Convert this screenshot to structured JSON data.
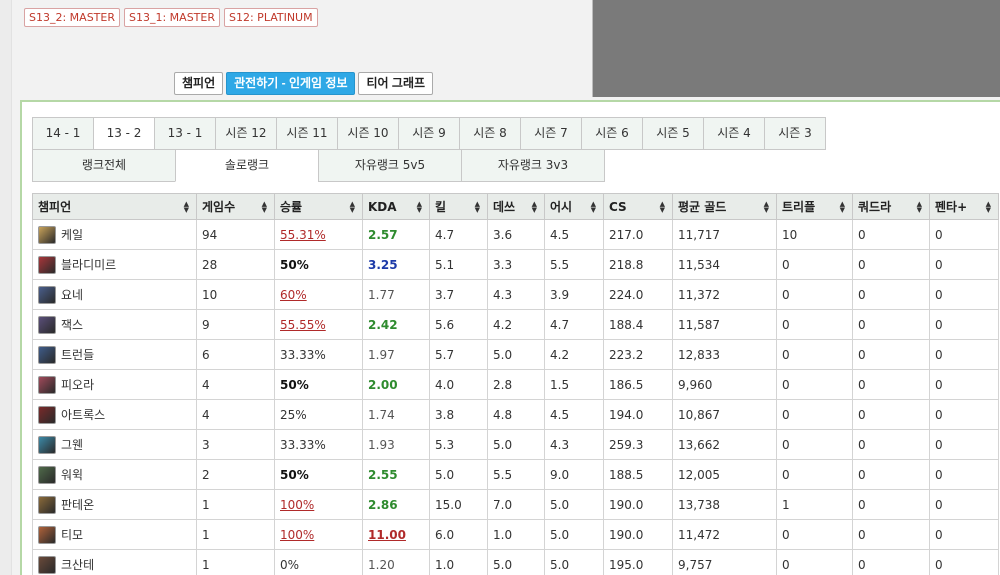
{
  "tier_badges": [
    "S13_2: MASTER",
    "S13_1: MASTER",
    "S12: PLATINUM"
  ],
  "view_tabs": [
    {
      "label": "챔피언",
      "active": false
    },
    {
      "label": "관전하기 - 인게임 정보",
      "active": true
    },
    {
      "label": "티어 그래프",
      "active": false
    }
  ],
  "season_tabs": [
    {
      "label": "14 - 1",
      "active": false
    },
    {
      "label": "13 - 2",
      "active": true
    },
    {
      "label": "13 - 1",
      "active": false
    },
    {
      "label": "시즌 12",
      "active": false
    },
    {
      "label": "시즌 11",
      "active": false
    },
    {
      "label": "시즌 10",
      "active": false
    },
    {
      "label": "시즌 9",
      "active": false
    },
    {
      "label": "시즌 8",
      "active": false
    },
    {
      "label": "시즌 7",
      "active": false
    },
    {
      "label": "시즌 6",
      "active": false
    },
    {
      "label": "시즌 5",
      "active": false
    },
    {
      "label": "시즌 4",
      "active": false
    },
    {
      "label": "시즌 3",
      "active": false
    }
  ],
  "rank_tabs": [
    {
      "label": "랭크전체",
      "active": false
    },
    {
      "label": "솔로랭크",
      "active": true
    },
    {
      "label": "자유랭크 5v5",
      "active": false
    },
    {
      "label": "자유랭크 3v3",
      "active": false
    }
  ],
  "table": {
    "headers": [
      "챔피언",
      "게임수",
      "승률",
      "KDA",
      "킬",
      "데쓰",
      "어시",
      "CS",
      "평균 골드",
      "트리플",
      "쿼드라",
      "펜타+"
    ],
    "rows": [
      {
        "champion": "케일",
        "games": "94",
        "winrate": "55.31%",
        "wr_style": "red",
        "kda": "2.57",
        "kda_style": "green",
        "kills": "4.7",
        "deaths": "3.6",
        "assists": "4.5",
        "cs": "217.0",
        "gold": "11,717",
        "triple": "10",
        "quadra": "0",
        "penta": "0",
        "icon_color": "#c9a35a"
      },
      {
        "champion": "블라디미르",
        "games": "28",
        "winrate": "50%",
        "wr_style": "black",
        "kda": "3.25",
        "kda_style": "blue",
        "kills": "5.1",
        "deaths": "3.3",
        "assists": "5.5",
        "cs": "218.8",
        "gold": "11,534",
        "triple": "0",
        "quadra": "0",
        "penta": "0",
        "icon_color": "#a8363a"
      },
      {
        "champion": "요네",
        "games": "10",
        "winrate": "60%",
        "wr_style": "red",
        "kda": "1.77",
        "kda_style": "gray",
        "kills": "3.7",
        "deaths": "4.3",
        "assists": "3.9",
        "cs": "224.0",
        "gold": "11,372",
        "triple": "0",
        "quadra": "0",
        "penta": "0",
        "icon_color": "#4a5f8c"
      },
      {
        "champion": "잭스",
        "games": "9",
        "winrate": "55.55%",
        "wr_style": "red",
        "kda": "2.42",
        "kda_style": "green",
        "kills": "5.6",
        "deaths": "4.2",
        "assists": "4.7",
        "cs": "188.4",
        "gold": "11,587",
        "triple": "0",
        "quadra": "0",
        "penta": "0",
        "icon_color": "#5a4f7a"
      },
      {
        "champion": "트런들",
        "games": "6",
        "winrate": "33.33%",
        "wr_style": "plain",
        "kda": "1.97",
        "kda_style": "gray",
        "kills": "5.7",
        "deaths": "5.0",
        "assists": "4.2",
        "cs": "223.2",
        "gold": "12,833",
        "triple": "0",
        "quadra": "0",
        "penta": "0",
        "icon_color": "#3f5c8a"
      },
      {
        "champion": "피오라",
        "games": "4",
        "winrate": "50%",
        "wr_style": "black",
        "kda": "2.00",
        "kda_style": "green",
        "kills": "4.0",
        "deaths": "2.8",
        "assists": "1.5",
        "cs": "186.5",
        "gold": "9,960",
        "triple": "0",
        "quadra": "0",
        "penta": "0",
        "icon_color": "#a04a5a"
      },
      {
        "champion": "아트록스",
        "games": "4",
        "winrate": "25%",
        "wr_style": "plain",
        "kda": "1.74",
        "kda_style": "gray",
        "kills": "3.8",
        "deaths": "4.8",
        "assists": "4.5",
        "cs": "194.0",
        "gold": "10,867",
        "triple": "0",
        "quadra": "0",
        "penta": "0",
        "icon_color": "#7a2a2a"
      },
      {
        "champion": "그웬",
        "games": "3",
        "winrate": "33.33%",
        "wr_style": "plain",
        "kda": "1.93",
        "kda_style": "gray",
        "kills": "5.3",
        "deaths": "5.0",
        "assists": "4.3",
        "cs": "259.3",
        "gold": "13,662",
        "triple": "0",
        "quadra": "0",
        "penta": "0",
        "icon_color": "#3c8aa8"
      },
      {
        "champion": "워윅",
        "games": "2",
        "winrate": "50%",
        "wr_style": "black",
        "kda": "2.55",
        "kda_style": "green",
        "kills": "5.0",
        "deaths": "5.5",
        "assists": "9.0",
        "cs": "188.5",
        "gold": "12,005",
        "triple": "0",
        "quadra": "0",
        "penta": "0",
        "icon_color": "#4f6a4a"
      },
      {
        "champion": "판테온",
        "games": "1",
        "winrate": "100%",
        "wr_style": "red",
        "kda": "2.86",
        "kda_style": "green",
        "kills": "15.0",
        "deaths": "7.0",
        "assists": "5.0",
        "cs": "190.0",
        "gold": "13,738",
        "triple": "1",
        "quadra": "0",
        "penta": "0",
        "icon_color": "#8a6a3a"
      },
      {
        "champion": "티모",
        "games": "1",
        "winrate": "100%",
        "wr_style": "red",
        "kda": "11.00",
        "kda_style": "red",
        "kills": "6.0",
        "deaths": "1.0",
        "assists": "5.0",
        "cs": "190.0",
        "gold": "11,472",
        "triple": "0",
        "quadra": "0",
        "penta": "0",
        "icon_color": "#b0623a"
      },
      {
        "champion": "크산테",
        "games": "1",
        "winrate": "0%",
        "wr_style": "plain",
        "kda": "1.20",
        "kda_style": "gray",
        "kills": "1.0",
        "deaths": "5.0",
        "assists": "5.0",
        "cs": "195.0",
        "gold": "9,757",
        "triple": "0",
        "quadra": "0",
        "penta": "0",
        "icon_color": "#6a4a3a"
      }
    ]
  }
}
